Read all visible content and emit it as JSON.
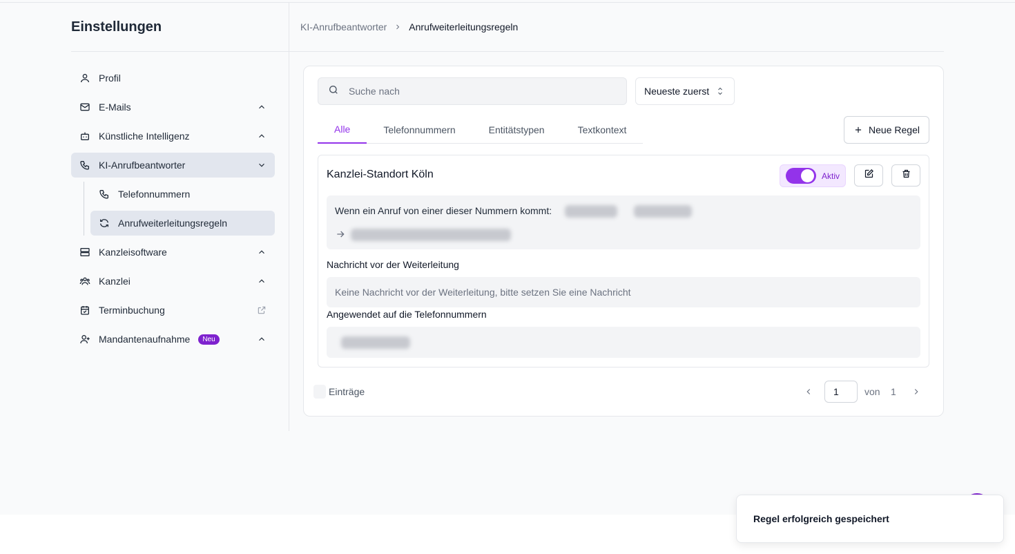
{
  "sidebar": {
    "title": "Einstellungen",
    "items": [
      {
        "label": "Profil",
        "icon": "user-icon"
      },
      {
        "label": "E-Mails",
        "icon": "mail-icon"
      },
      {
        "label": "Künstliche Intelligenz",
        "icon": "bot-icon"
      },
      {
        "label": "KI-Anrufbeantworter",
        "icon": "phone-icon",
        "active": true,
        "expanded": true
      },
      {
        "label": "Kanzleisoftware",
        "icon": "server-icon"
      },
      {
        "label": "Kanzlei",
        "icon": "users-icon"
      },
      {
        "label": "Terminbuchung",
        "icon": "calendar-check-icon",
        "external": true
      },
      {
        "label": "Mandantenaufnahme",
        "icon": "user-plus-icon",
        "badge": "Neu"
      }
    ],
    "subitems": [
      {
        "label": "Telefonnummern",
        "icon": "phone-icon"
      },
      {
        "label": "Anrufweiterleitungsregeln",
        "icon": "refresh-icon",
        "active": true
      }
    ]
  },
  "breadcrumb": {
    "items": [
      "KI-Anrufbeantworter",
      "Anrufweiterleitungsregeln"
    ]
  },
  "toolbar": {
    "search_placeholder": "Suche nach",
    "sort_label": "Neueste zuerst",
    "new_rule_label": "Neue Regel"
  },
  "tabs": [
    {
      "label": "Alle",
      "active": true
    },
    {
      "label": "Telefonnummern"
    },
    {
      "label": "Entitätstypen"
    },
    {
      "label": "Textkontext"
    }
  ],
  "rule": {
    "title": "Kanzlei-Standort Köln",
    "status_label": "Aktiv",
    "active": true,
    "condition_text": "Wenn ein Anruf von einer dieser Nummern kommt:",
    "message_label": "Nachricht vor der Weiterleitung",
    "message_placeholder": "Keine Nachricht vor der Weiterleitung, bitte setzen Sie eine Nachricht",
    "applied_label": "Angewendet auf die Telefonnummern"
  },
  "pagination": {
    "entries_label": "Einträge",
    "current_page": "1",
    "of_label": "von",
    "total_pages": "1"
  },
  "toast": {
    "message": "Regel erfolgreich gespeichert"
  },
  "colors": {
    "accent": "#9333ea",
    "active_bg": "#e2e6ee"
  }
}
